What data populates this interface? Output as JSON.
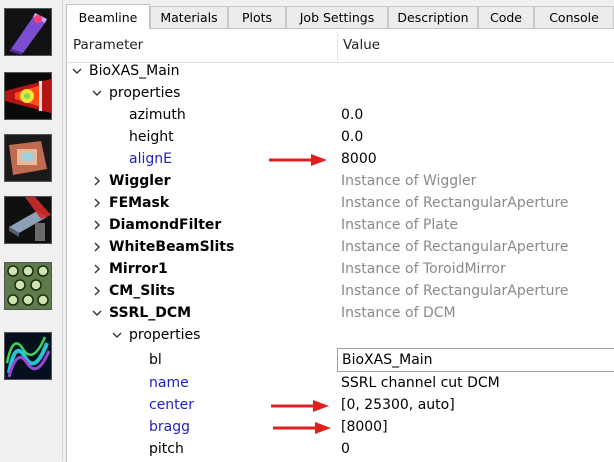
{
  "toolbar": {
    "tools": [
      {
        "icon": "beamline-source-icon"
      },
      {
        "icon": "beam-trace-icon"
      },
      {
        "icon": "screen-footprint-icon"
      },
      {
        "icon": "mirror-element-icon"
      },
      {
        "icon": "lattice-structure-icon"
      },
      {
        "icon": "wave-field-icon"
      }
    ]
  },
  "tabs": [
    "Beamline",
    "Materials",
    "Plots",
    "Job Settings",
    "Description",
    "Code",
    "Console"
  ],
  "active_tab": "Beamline",
  "table": {
    "col_parameter": "Parameter",
    "col_value": "Value"
  },
  "tree": {
    "root": "BioXAS_Main",
    "properties_label": "properties",
    "root_props": [
      {
        "name": "azimuth",
        "value": "0.0"
      },
      {
        "name": "height",
        "value": "0.0"
      },
      {
        "name": "alignE",
        "value": "8000"
      }
    ],
    "elements": [
      {
        "name": "Wiggler",
        "value": "Instance of Wiggler"
      },
      {
        "name": "FEMask",
        "value": "Instance of RectangularAperture"
      },
      {
        "name": "DiamondFilter",
        "value": "Instance of Plate"
      },
      {
        "name": "WhiteBeamSlits",
        "value": "Instance of RectangularAperture"
      },
      {
        "name": "Mirror1",
        "value": "Instance of ToroidMirror"
      },
      {
        "name": "CM_Slits",
        "value": "Instance of RectangularAperture"
      },
      {
        "name": "SSRL_DCM",
        "value": "Instance of DCM"
      }
    ],
    "dcm_props_label": "properties",
    "dcm_props": [
      {
        "name": "bl",
        "value": "BioXAS_Main"
      },
      {
        "name": "name",
        "value": "SSRL channel cut DCM"
      },
      {
        "name": "center",
        "value": "[0, 25300, auto]"
      },
      {
        "name": "bragg",
        "value": "[8000]"
      },
      {
        "name": "pitch",
        "value": "0"
      }
    ]
  },
  "colors": {
    "arrow": "#e02020",
    "blue_param": "#1f1fbf",
    "instance_gray": "#8a8a8a"
  }
}
